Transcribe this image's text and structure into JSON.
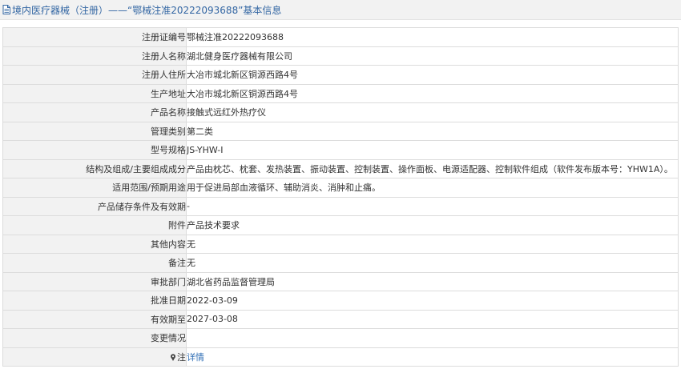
{
  "header": {
    "title": "境内医疗器械（注册）——“鄂械注准20222093688”基本信息"
  },
  "rows": [
    {
      "label": "注册证编号",
      "value": "鄂械注准20222093688"
    },
    {
      "label": "注册人名称",
      "value": "湖北健身医疗器械有限公司"
    },
    {
      "label": "注册人住所",
      "value": "大冶市城北新区铜源西路4号"
    },
    {
      "label": "生产地址",
      "value": "大冶市城北新区铜源西路4号"
    },
    {
      "label": "产品名称",
      "value": "接触式远红外热疗仪"
    },
    {
      "label": "管理类别",
      "value": "第二类"
    },
    {
      "label": "型号规格",
      "value": "JS-YHW-I"
    },
    {
      "label": "结构及组成/主要组成成分",
      "value": "产品由枕芯、枕套、发热装置、振动装置、控制装置、操作面板、电源适配器、控制软件组成（软件发布版本号：YHW1A）。"
    },
    {
      "label": "适用范围/预期用途",
      "value": "用于促进局部血液循环、辅助消炎、消肿和止痛。"
    },
    {
      "label": "产品储存条件及有效期",
      "value": "-"
    },
    {
      "label": "附件",
      "value": "产品技术要求"
    },
    {
      "label": "其他内容",
      "value": "无"
    },
    {
      "label": "备注",
      "value": "无"
    },
    {
      "label": "审批部门",
      "value": "湖北省药品监督管理局"
    },
    {
      "label": "批准日期",
      "value": "2022-03-09"
    },
    {
      "label": "有效期至",
      "value": "2027-03-08"
    },
    {
      "label": "变更情况",
      "value": ""
    }
  ],
  "note_row": {
    "label": "注",
    "link_text": "详情",
    "icon": "pin-icon"
  },
  "colors": {
    "title_text": "#3366a3",
    "link": "#2f6eb5",
    "label_background": "#f2f2f2",
    "border": "#dcdcdc"
  }
}
